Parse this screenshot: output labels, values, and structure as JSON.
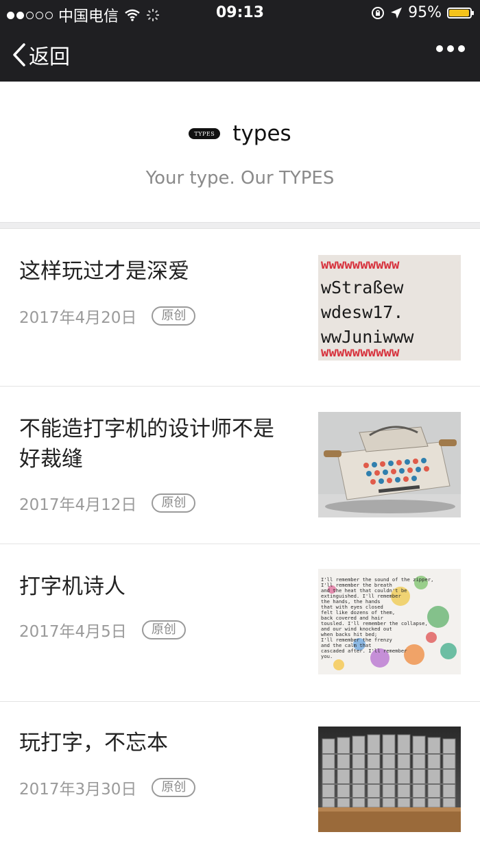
{
  "status_bar": {
    "carrier": "中国电信",
    "time": "09:13",
    "battery": "95%",
    "battery_level": 0.95,
    "signal_bars": 2
  },
  "nav": {
    "back_label": "返回"
  },
  "account": {
    "logo_text": "TYPES",
    "name": "types",
    "tagline": "Your type. Our TYPES"
  },
  "articles": [
    {
      "title": "这样玩过才是深爱",
      "date": "2017年4月20日",
      "badge": "原创"
    },
    {
      "title": "不能造打字机的设计师不是好裁缝",
      "date": "2017年4月12日",
      "badge": "原创"
    },
    {
      "title": "打字机诗人",
      "date": "2017年4月5日",
      "badge": "原创"
    },
    {
      "title": "玩打字，不忘本",
      "date": "2017年3月30日",
      "badge": "原创"
    }
  ],
  "thumb1_lines": [
    "wwwwwwwwww",
    "wStraßew",
    "wdesw17.",
    "wwJuniwww",
    "wwwwwwwwww"
  ],
  "thumb3_lines": [
    "I'll remember the sound of the zipper,",
    "I'll remember the breath",
    "and the heat that couldn't be",
    "extinguished.  I'll remember",
    "the hands, the hands",
    "that with eyes closed",
    "felt like dozens of them,",
    "back covered and hair",
    "tousled.  I'll remember the collapse,",
    "and our wind knocked out",
    "when backs hit bed;",
    "I'll remember the frenzy",
    "and the calm that",
    "cascaded after.  I'll remember",
    "you."
  ],
  "colors": {
    "topbar": "#1f1f22",
    "battery": "#f4c21a",
    "date_gray": "#9a9a9a"
  }
}
